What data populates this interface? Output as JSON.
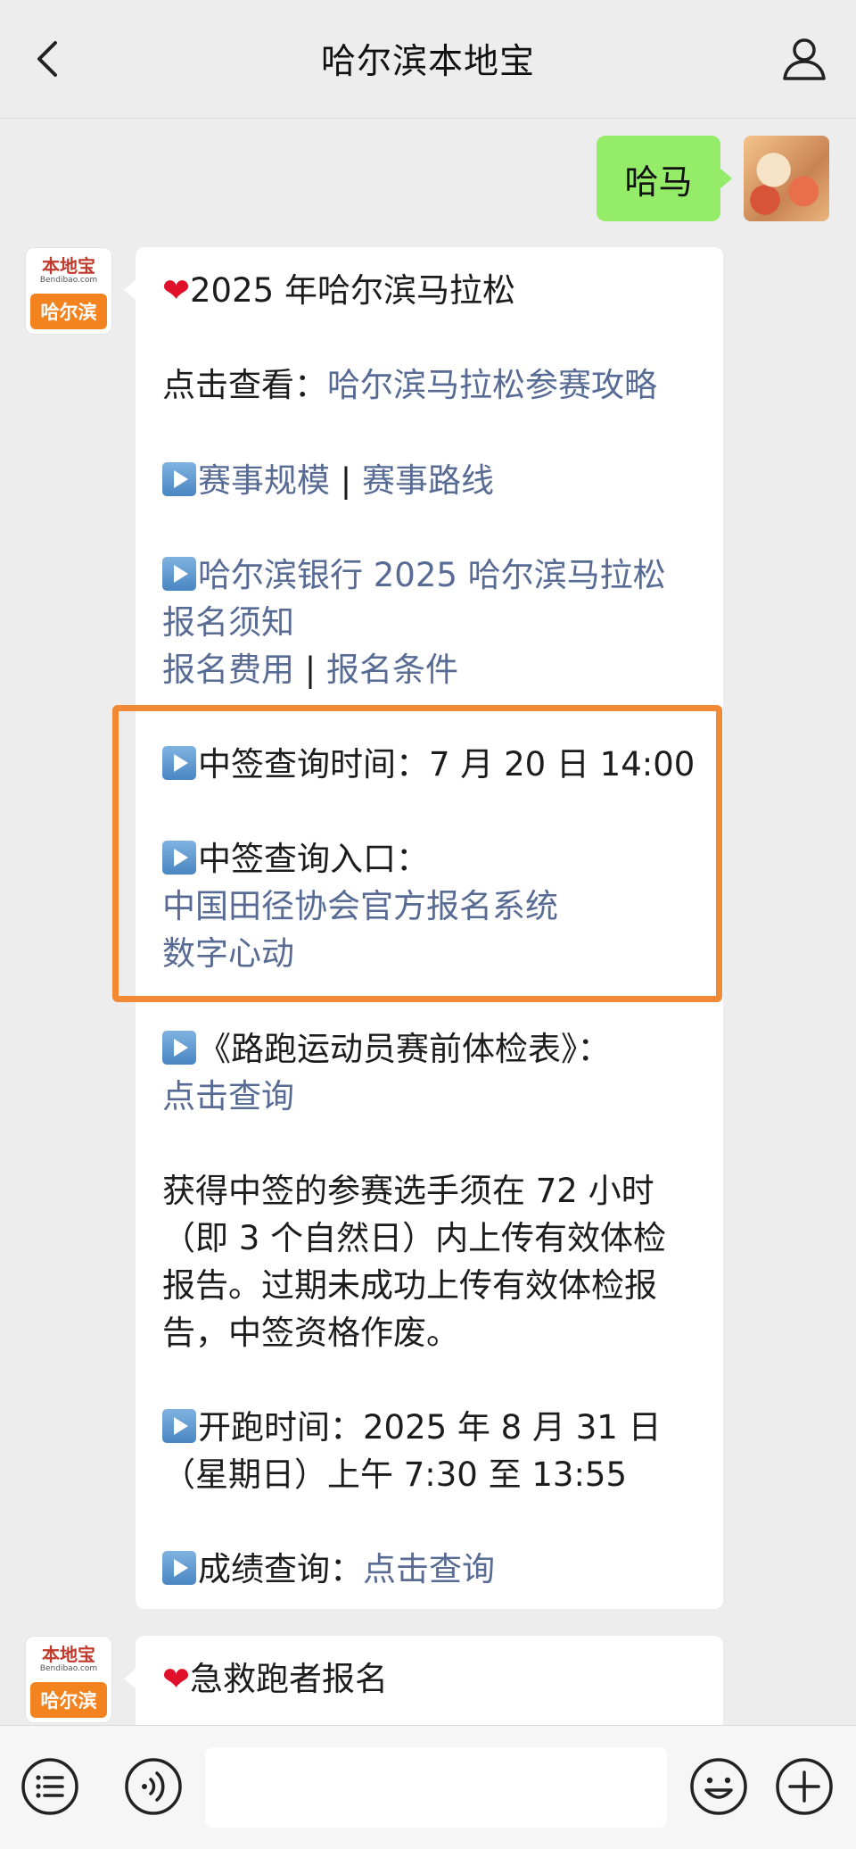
{
  "header": {
    "title": "哈尔滨本地宝"
  },
  "outgoing": {
    "text": "哈马"
  },
  "bot": {
    "brand": "本地宝",
    "site": "Bendibao.com",
    "city": "哈尔滨"
  },
  "message": {
    "heart_title": "2025 年哈尔滨马拉松",
    "view_prefix": "点击查看：",
    "view_link": "哈尔滨马拉松参赛攻略",
    "scale_link": "赛事规模",
    "route_link": "赛事路线",
    "sep": " | ",
    "notice_link_1": "哈尔滨银行 2025 哈尔滨马拉松",
    "notice_link_2": "报名须知",
    "fee_link": "报名费用",
    "condition_link": "报名条件",
    "draw_time": "中签查询时间：7 月 20 日 14:00",
    "draw_entry": "中签查询入口：",
    "entry_link_1": "中国田径协会官方报名系统",
    "entry_link_2": "数字心动",
    "form_title": "《路跑运动员赛前体检表》：",
    "form_link": "点击查询",
    "para_1": "获得中签的参赛选手须在 72 小时",
    "para_2": "（即 3 个自然日）内上传有效体检",
    "para_3": "报告。过期未成功上传有效体检报",
    "para_4": "告，中签资格作废。",
    "start_1": "开跑时间：2025 年 8 月 31 日",
    "start_2": "（星期日）上午 7:30 至 13:55",
    "result_prefix": "成绩查询：",
    "result_link": "点击查询"
  },
  "message2": {
    "heart_title": "急救跑者报名"
  },
  "colors": {
    "link": "#576b95",
    "outgoing_bubble": "#95ec69",
    "highlight": "#f28a35",
    "heart": "#e0102a"
  }
}
